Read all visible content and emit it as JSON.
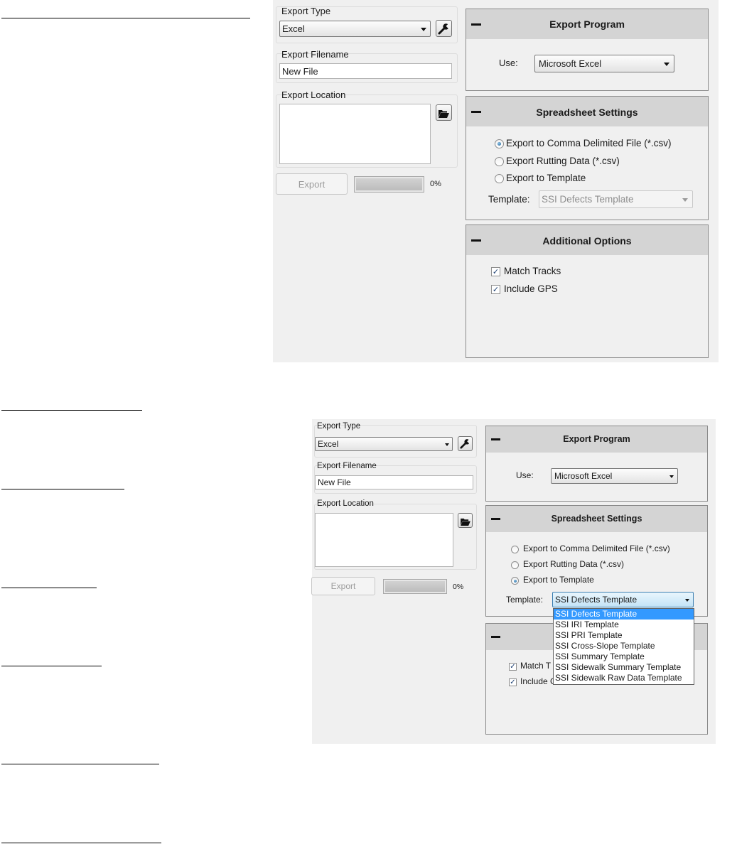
{
  "screen1": {
    "export_type": {
      "label": "Export Type",
      "value": "Excel",
      "settings_icon": "wrench-icon"
    },
    "export_filename": {
      "label": "Export Filename",
      "value": "New File"
    },
    "export_location": {
      "label": "Export Location",
      "value": "",
      "browse_icon": "folder-open-icon"
    },
    "export_button": "Export",
    "progress": {
      "percent_text": "0%",
      "value": 0
    },
    "export_program": {
      "title": "Export Program",
      "use_label": "Use:",
      "use_value": "Microsoft Excel"
    },
    "spreadsheet_settings": {
      "title": "Spreadsheet Settings",
      "options": [
        {
          "label": "Export to Comma Delimited File (*.csv)",
          "selected": true
        },
        {
          "label": "Export Rutting Data (*.csv)",
          "selected": false
        },
        {
          "label": "Export to Template",
          "selected": false
        }
      ],
      "template_label": "Template:",
      "template_value": "SSI Defects Template",
      "template_enabled": false
    },
    "additional_options": {
      "title": "Additional Options",
      "options": [
        {
          "label": "Match Tracks",
          "checked": true
        },
        {
          "label": "Include GPS",
          "checked": true
        }
      ]
    }
  },
  "screen2": {
    "export_type": {
      "label": "Export Type",
      "value": "Excel",
      "settings_icon": "wrench-icon"
    },
    "export_filename": {
      "label": "Export Filename",
      "value": "New File"
    },
    "export_location": {
      "label": "Export Location",
      "value": "",
      "browse_icon": "folder-open-icon"
    },
    "export_button": "Export",
    "progress": {
      "percent_text": "0%",
      "value": 0
    },
    "export_program": {
      "title": "Export Program",
      "use_label": "Use:",
      "use_value": "Microsoft Excel"
    },
    "spreadsheet_settings": {
      "title": "Spreadsheet Settings",
      "options": [
        {
          "label": "Export to Comma Delimited File (*.csv)",
          "selected": false
        },
        {
          "label": "Export Rutting Data (*.csv)",
          "selected": false
        },
        {
          "label": "Export to Template",
          "selected": true
        }
      ],
      "template_label": "Template:",
      "template_value": "SSI Defects Template",
      "template_enabled": true,
      "template_dropdown_open": true,
      "template_options": [
        "SSI Defects Template",
        "SSI IRI Template",
        "SSI PRI Template",
        "SSI Cross-Slope Template",
        "SSI Summary Template",
        "SSI Sidewalk Summary Template",
        "SSI Sidewalk Raw Data Template"
      ],
      "template_highlighted_index": 0
    },
    "additional_options": {
      "options": [
        {
          "label": "Match Tracks",
          "visible_text": "Match T",
          "checked": true
        },
        {
          "label": "Include GPS",
          "visible_text": "Include G",
          "checked": true
        }
      ]
    }
  },
  "colors": {
    "window_bg": "#f0f0f0",
    "panel_header_bg": "#d4d4d4",
    "selection_blue": "#3399ff",
    "check_blue": "#1b3f72"
  }
}
